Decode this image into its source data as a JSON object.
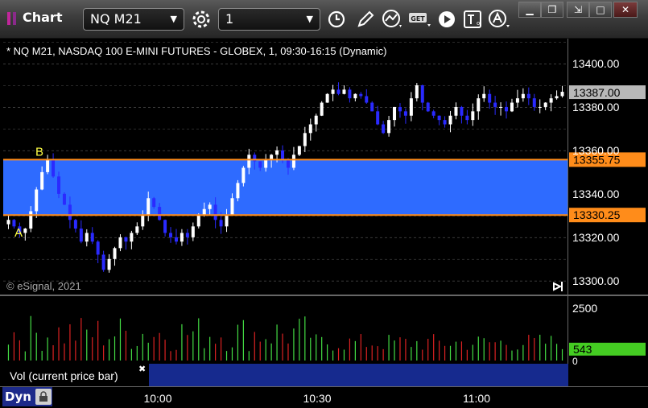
{
  "window": {
    "title": "Chart"
  },
  "toolbar": {
    "symbol": "NQ M21",
    "interval": "1"
  },
  "chart_info": "* NQ M21, NASDAQ 100 E-MINI FUTURES - GLOBEX, 1, 09:30-16:15 (Dynamic)",
  "copyright": "© eSignal, 2021",
  "study_label": "Vol (current price bar)",
  "footer_label": "Dyn",
  "chart_data": [
    {
      "type": "candlestick",
      "ylim": [
        13294,
        13410
      ],
      "ticks": [
        "13300.00",
        "13320.00",
        "13340.00",
        "13360.00",
        "13380.00",
        "13400.00"
      ],
      "x_ticks": [
        "10:00",
        "10:30",
        "11:00"
      ],
      "last_price": "13387.00",
      "levels": [
        {
          "label": "B",
          "value": 13355.75,
          "text": "13355.75"
        },
        {
          "label": "A",
          "value": 13330.25,
          "text": "13330.25"
        }
      ],
      "highlight_range": [
        13330.25,
        13355.75
      ],
      "series_close": [
        13328,
        13325,
        13322,
        13324,
        13332,
        13342,
        13350,
        13356,
        13348,
        13340,
        13335,
        13328,
        13324,
        13318,
        13322,
        13318,
        13312,
        13305,
        13310,
        13315,
        13320,
        13318,
        13322,
        13325,
        13330,
        13338,
        13334,
        13328,
        13322,
        13320,
        13318,
        13322,
        13320,
        13325,
        13330,
        13333,
        13335,
        13328,
        13325,
        13330,
        13338,
        13345,
        13352,
        13358,
        13355,
        13352,
        13356,
        13358,
        13360,
        13356,
        13352,
        13358,
        13362,
        13368,
        13372,
        13376,
        13382,
        13386,
        13388,
        13386,
        13388,
        13384,
        13386,
        13385,
        13382,
        13378,
        13372,
        13368,
        13374,
        13380,
        13378,
        13376,
        13384,
        13390,
        13382,
        13378,
        13376,
        13374,
        13372,
        13376,
        13380,
        13376,
        13374,
        13378,
        13384,
        13386,
        13382,
        13380,
        13380,
        13378,
        13382,
        13384,
        13386,
        13384,
        13380,
        13380,
        13382,
        13384,
        13385,
        13387
      ]
    },
    {
      "type": "bar",
      "title": "Vol (current price bar)",
      "ylim": [
        0,
        3000
      ],
      "ticks": [
        "2500"
      ],
      "zero_label": "0",
      "last_value": "543"
    }
  ]
}
